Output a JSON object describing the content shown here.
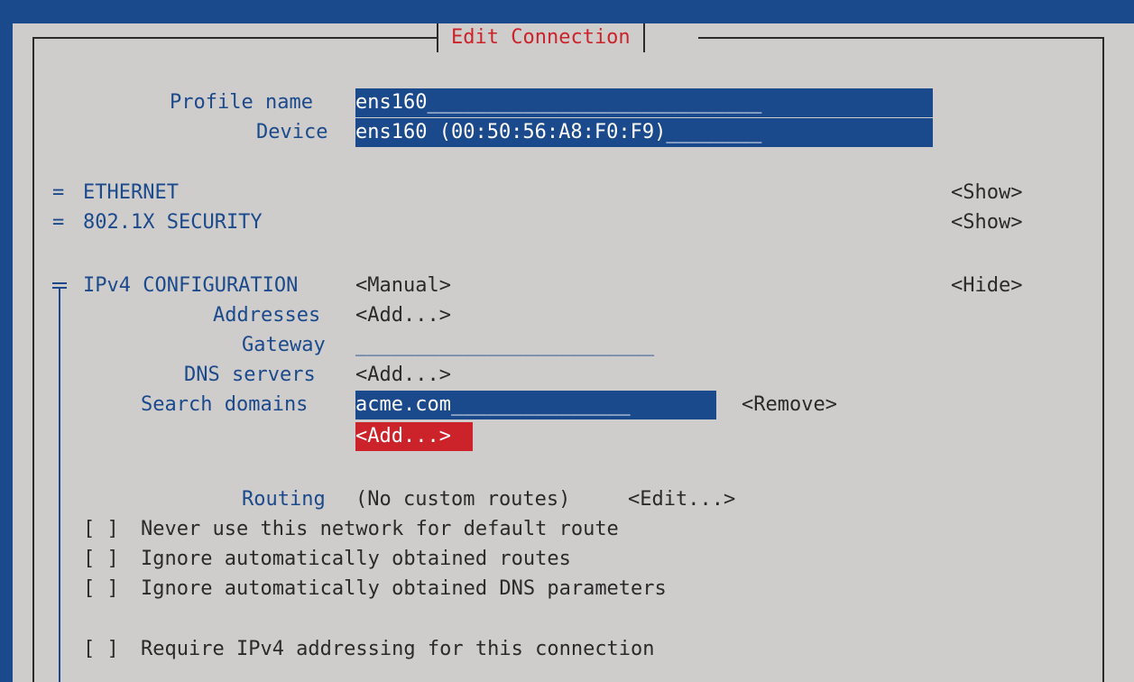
{
  "dialog": {
    "title": "Edit Connection"
  },
  "profile": {
    "label": "Profile name",
    "value": "ens160____________________________"
  },
  "device": {
    "label": "Device",
    "value": "ens160 (00:50:56:A8:F0:F9)________"
  },
  "sections": {
    "ethernet": {
      "marker": "=",
      "label": "ETHERNET",
      "toggle": "<Show>"
    },
    "security": {
      "marker": "=",
      "label": "802.1X SECURITY",
      "toggle": "<Show>"
    },
    "ipv4": {
      "label": "IPv4 CONFIGURATION",
      "mode": "<Manual>",
      "toggle": "<Hide>"
    }
  },
  "ipv4": {
    "addresses": {
      "label": "Addresses",
      "button": "<Add...>"
    },
    "gateway": {
      "label": "Gateway",
      "value": "_________________________"
    },
    "dns": {
      "label": "DNS servers",
      "button": "<Add...>"
    },
    "search": {
      "label": "Search domains",
      "value": "acme.com_______________",
      "remove": "<Remove>",
      "add": "<Add...>"
    },
    "routing": {
      "label": "Routing",
      "value": "(No custom routes)",
      "edit": "<Edit...>"
    },
    "checkboxes": [
      {
        "box": "[ ]",
        "label": "Never use this network for default route"
      },
      {
        "box": "[ ]",
        "label": "Ignore automatically obtained routes"
      },
      {
        "box": "[ ]",
        "label": "Ignore automatically obtained DNS parameters"
      },
      {
        "box": "[ ]",
        "label": "Require IPv4 addressing for this connection"
      }
    ]
  },
  "colors": {
    "background": "#1b4a8c",
    "panel": "#cfcccc",
    "accent_red": "#cc2229",
    "text_dark": "#2a2a2a"
  }
}
